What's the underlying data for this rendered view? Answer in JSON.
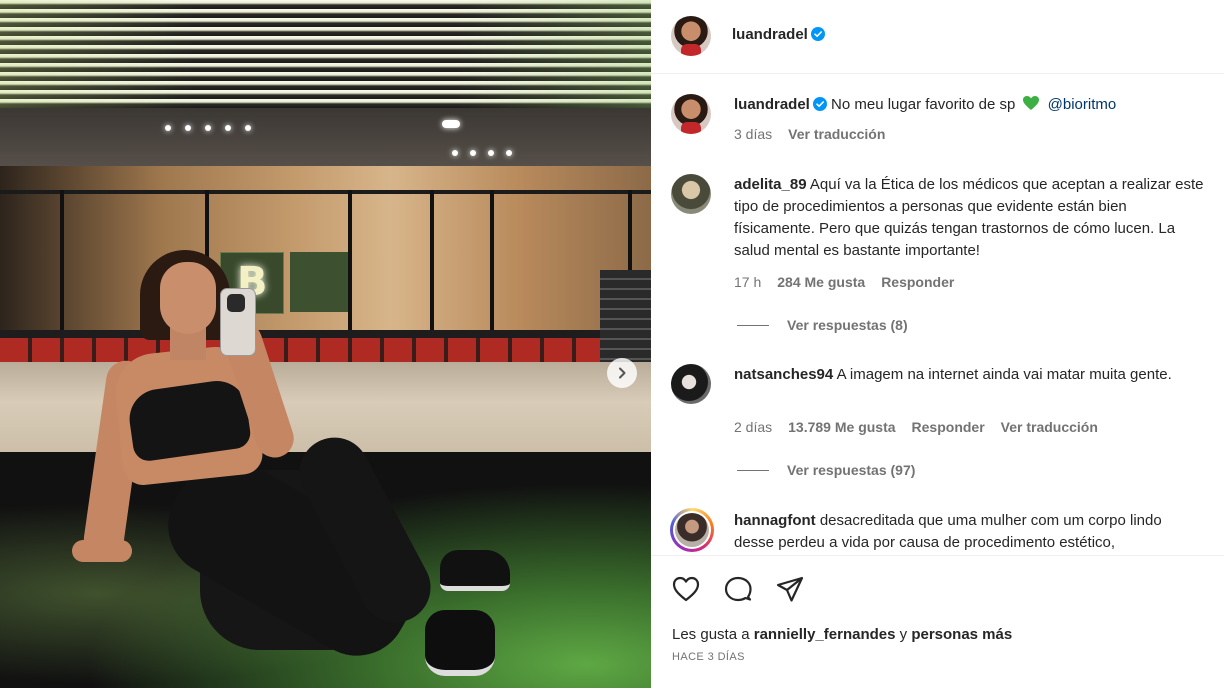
{
  "post": {
    "author": "luandradel",
    "caption_text": "No meu lugar favorito de sp",
    "caption_emoji": "💚",
    "caption_mention": "@bioritmo",
    "caption_age": "3 días",
    "caption_translate": "Ver traducción"
  },
  "comments": [
    {
      "user": "adelita_89",
      "text": "Aquí va la Ética de los médicos que aceptan a realizar este tipo de procedimientos a personas que evidente están bien físicamente. Pero que quizás tengan trastornos de cómo lucen. La salud mental es bastante importante!",
      "age": "17 h",
      "likes": "284 Me gusta",
      "reply": "Responder",
      "view_replies": "Ver respuestas (8)"
    },
    {
      "user": "natsanches94",
      "text": "A imagem na internet ainda vai matar muita gente.",
      "age": "2 días",
      "likes": "13.789 Me gusta",
      "reply": "Responder",
      "translate": "Ver traducción",
      "view_replies": "Ver respuestas (97)"
    },
    {
      "user": "hannagfont",
      "text": "desacreditada que uma mulher com um corpo lindo desse perdeu a vida por causa de procedimento estético,"
    }
  ],
  "footer": {
    "likes_prefix": "Les gusta a",
    "likes_user": "rannielly_fernandes",
    "likes_join": "y",
    "likes_rest": "personas más",
    "posted_ago": "HACE 3 DÍAS"
  },
  "photo": {
    "neon_sign": "B"
  },
  "icons": [
    "verified-badge-icon",
    "heart-icon",
    "comment-icon",
    "share-icon",
    "chevron-right-icon",
    "green-heart-emoji"
  ],
  "colors": {
    "verified": "#0095f6",
    "link": "#00376b",
    "muted": "#737373",
    "green_heart": "#3cb043"
  }
}
